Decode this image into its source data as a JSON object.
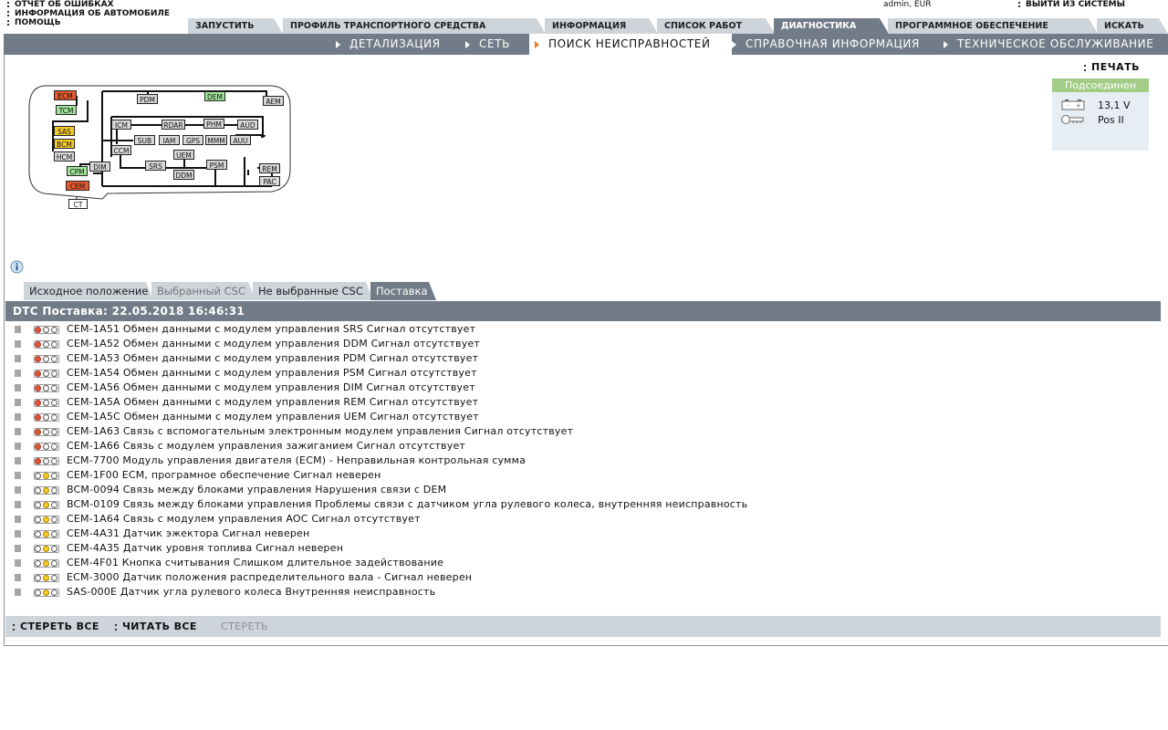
{
  "top_links": [
    "ОТЧЕТ ОБ ОШИБКАХ",
    "ИНФОРМАЦИЯ ОБ АВТОМОБИЛЕ",
    "ПОМОЩЬ"
  ],
  "user_info": "admin, EUR",
  "logout_label": "ВЫЙТИ ИЗ СИСТЕМЫ",
  "main_tabs": [
    {
      "label": "ЗАПУСТИТЬ",
      "active": false
    },
    {
      "label": "ПРОФИЛЬ ТРАНСПОРТНОГО СРЕДСТВА",
      "active": false
    },
    {
      "label": "ИНФОРМАЦИЯ",
      "active": false
    },
    {
      "label": "СПИСОК РАБОТ",
      "active": false
    },
    {
      "label": "ДИАГНОСТИКА",
      "active": true
    },
    {
      "label": "ПРОГРАММНОЕ ОБЕСПЕЧЕНИЕ",
      "active": false
    },
    {
      "label": "ИСКАТЬ",
      "active": false
    }
  ],
  "sub_nav": [
    {
      "label": "ДЕТАЛИЗАЦИЯ",
      "active": false
    },
    {
      "label": "СЕТЬ",
      "active": false
    },
    {
      "label": "ПОИСК НЕИСПРАВНОСТЕЙ",
      "active": true
    },
    {
      "label": "СПРАВОЧНАЯ ИНФОРМАЦИЯ",
      "active": false
    },
    {
      "label": "ТЕХНИЧЕСКОЕ ОБСЛУЖИВАНИЕ",
      "active": false
    }
  ],
  "print_label": "ПЕЧАТЬ",
  "status": {
    "header": "Подсоединен",
    "voltage": "13,1 V",
    "ignition": "Pos II",
    "header_color": "#a3cc86"
  },
  "modules": [
    {
      "name": "ECM",
      "status": "red"
    },
    {
      "name": "TCM",
      "status": "green"
    },
    {
      "name": "SAS",
      "status": "yellow"
    },
    {
      "name": "BCM",
      "status": "yellow"
    },
    {
      "name": "HCM",
      "status": "gray"
    },
    {
      "name": "CPM",
      "status": "green"
    },
    {
      "name": "CEM",
      "status": "red"
    },
    {
      "name": "CT",
      "status": "white"
    },
    {
      "name": "DIM",
      "status": "gray"
    },
    {
      "name": "PDM",
      "status": "gray"
    },
    {
      "name": "DEM",
      "status": "green"
    },
    {
      "name": "AEM",
      "status": "gray"
    },
    {
      "name": "ICM",
      "status": "gray"
    },
    {
      "name": "RDAR",
      "status": "gray"
    },
    {
      "name": "PHM",
      "status": "gray"
    },
    {
      "name": "AUD",
      "status": "gray"
    },
    {
      "name": "SUB",
      "status": "gray"
    },
    {
      "name": "IAM",
      "status": "gray"
    },
    {
      "name": "GPS",
      "status": "gray"
    },
    {
      "name": "MMM",
      "status": "gray"
    },
    {
      "name": "AUU",
      "status": "gray"
    },
    {
      "name": "CCM",
      "status": "gray"
    },
    {
      "name": "UEM",
      "status": "gray"
    },
    {
      "name": "SRS",
      "status": "gray"
    },
    {
      "name": "DDM",
      "status": "gray"
    },
    {
      "name": "PSM",
      "status": "gray"
    },
    {
      "name": "REM",
      "status": "gray"
    },
    {
      "name": "PAC",
      "status": "gray"
    }
  ],
  "csc_tabs": [
    {
      "label": "Исходное положение",
      "state": "normal"
    },
    {
      "label": "Выбранный CSC",
      "state": "dim"
    },
    {
      "label": "Не выбранные CSC",
      "state": "normal"
    },
    {
      "label": "Поставка",
      "state": "active"
    }
  ],
  "dtc_header": "DTC Поставка: 22.05.2018 16:46:31",
  "dtc_items": [
    {
      "text": "CEM-1A51 Обмен данными с модулем управления SRS Сигнал отсутствует",
      "severity": "red"
    },
    {
      "text": "CEM-1A52 Обмен данными с модулем управления DDM Сигнал отсутствует",
      "severity": "red"
    },
    {
      "text": "CEM-1A53 Обмен данными с модулем управления PDM Сигнал отсутствует",
      "severity": "red"
    },
    {
      "text": "CEM-1A54 Обмен данными с модулем управления PSM Сигнал отсутствует",
      "severity": "red"
    },
    {
      "text": "CEM-1A56 Обмен данными с модулем управления DIM Сигнал отсутствует",
      "severity": "red"
    },
    {
      "text": "CEM-1A5A Обмен данными с модулем управления REM Сигнал отсутствует",
      "severity": "red"
    },
    {
      "text": "CEM-1A5C Обмен данными с модулем управления UEM Сигнал отсутствует",
      "severity": "red"
    },
    {
      "text": "CEM-1A63 Связь с вспомогательным электронным модулем управления Сигнал отсутствует",
      "severity": "red"
    },
    {
      "text": "CEM-1A66 Связь с модулем управления зажиганием Сигнал отсутствует",
      "severity": "red"
    },
    {
      "text": "ECM-7700 Модуль управления двигателя (ECM) - Неправильная контрольная сумма",
      "severity": "red"
    },
    {
      "text": "CEM-1F00 ECM, програмное обеспечение  Сигнал неверен",
      "severity": "yellow"
    },
    {
      "text": "BCM-0094 Связь между блоками управления Нарушения связи с DEM",
      "severity": "yellow"
    },
    {
      "text": "BCM-0109 Связь между блоками управления Проблемы связи с датчиком угла рулевого колеса, внутренняя неисправность",
      "severity": "yellow"
    },
    {
      "text": "CEM-1A64 Связь с модулем управления AOC Сигнал отсутствует",
      "severity": "yellow"
    },
    {
      "text": "CEM-4A31 Датчик эжектора Сигнал неверен",
      "severity": "yellow"
    },
    {
      "text": "CEM-4A35 Датчик уровня топлива Сигнал неверен",
      "severity": "yellow"
    },
    {
      "text": "CEM-4F01 Кнопка считывания Слишком длительное задействование",
      "severity": "yellow"
    },
    {
      "text": "ECM-3000 Датчик положения распределительного вала - Сигнал неверен",
      "severity": "yellow"
    },
    {
      "text": "SAS-000E Датчик угла рулевого колеса Внутренняя неисправность",
      "severity": "yellow"
    }
  ],
  "actions": [
    {
      "label": "СТЕРЕТЬ ВСЕ",
      "enabled": true
    },
    {
      "label": "ЧИТАТЬ ВСЕ",
      "enabled": true
    },
    {
      "label": "СТЕРЕТЬ",
      "enabled": false
    }
  ],
  "colors": {
    "nav_bg": "#727c88",
    "tab_bg": "#cdd4da",
    "accent_arrow": "#e87a1a",
    "severity_red": "#e3582d",
    "severity_yellow": "#f6cc2a"
  }
}
